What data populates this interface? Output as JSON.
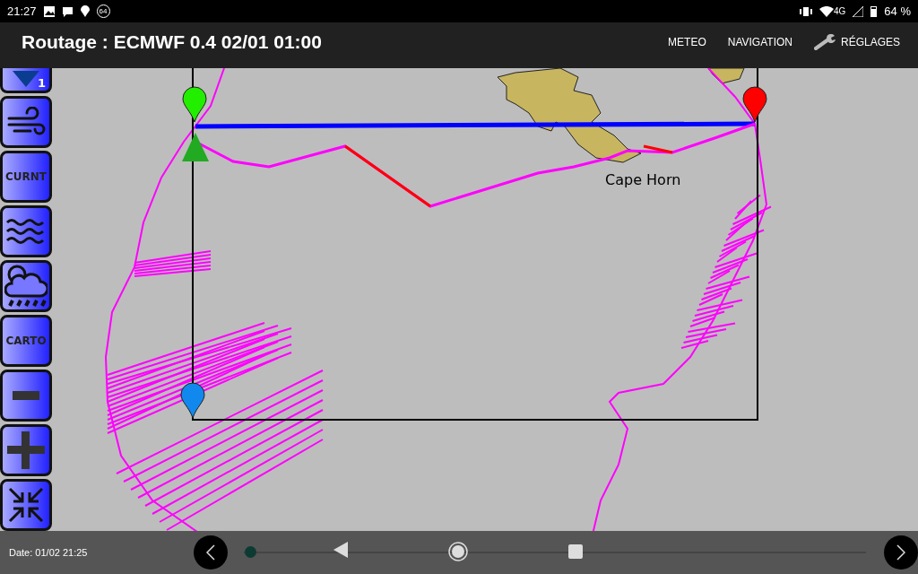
{
  "status_bar": {
    "time": "21:27",
    "badge": "64",
    "network": "4G",
    "battery": "64 %"
  },
  "app_bar": {
    "title": "Routage : ECMWF 0.4 02/01 01:00",
    "menu": [
      {
        "label": "METEO",
        "kind": "plain"
      },
      {
        "label": "NAVIGATION",
        "kind": "plain"
      },
      {
        "label": "RÉGLAGES",
        "kind": "wrench"
      }
    ]
  },
  "toolbar": [
    {
      "kind": "marker",
      "badge": "1"
    },
    {
      "kind": "wind"
    },
    {
      "kind": "text",
      "label": "CURNT"
    },
    {
      "kind": "waves"
    },
    {
      "kind": "weather"
    },
    {
      "kind": "text",
      "label": "CARTO"
    },
    {
      "kind": "minus"
    },
    {
      "kind": "plus"
    },
    {
      "kind": "collapse"
    }
  ],
  "map": {
    "place_label": "Cape Horn"
  },
  "bottom_bar": {
    "date": "Date: 01/02 21:25",
    "slider": {
      "level": 0.01
    }
  }
}
